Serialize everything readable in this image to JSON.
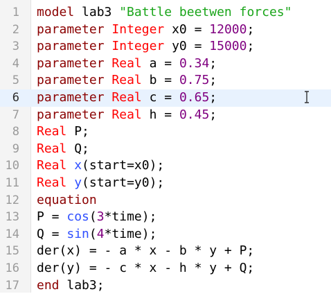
{
  "colors": {
    "keyword": "#8b0000",
    "type": "#ff0000",
    "string": "#1aa51a",
    "number": "#800080",
    "function": "#2f4fff",
    "current_line": "#e8f2fe"
  },
  "cursor": {
    "icon": "text-cursor-icon"
  },
  "editor": {
    "current_line": 6,
    "lines": [
      {
        "n": "1",
        "parts": [
          {
            "t": "kw",
            "v": "model"
          },
          {
            "t": "",
            "v": " lab3 "
          },
          {
            "t": "str",
            "v": "\"Battle beetwen forces\""
          }
        ]
      },
      {
        "n": "2",
        "parts": [
          {
            "t": "kw",
            "v": "parameter"
          },
          {
            "t": "",
            "v": " "
          },
          {
            "t": "typ",
            "v": "Integer"
          },
          {
            "t": "",
            "v": " x0 = "
          },
          {
            "t": "num",
            "v": "12000"
          },
          {
            "t": "",
            "v": ";"
          }
        ]
      },
      {
        "n": "3",
        "parts": [
          {
            "t": "kw",
            "v": "parameter"
          },
          {
            "t": "",
            "v": " "
          },
          {
            "t": "typ",
            "v": "Integer"
          },
          {
            "t": "",
            "v": " y0 = "
          },
          {
            "t": "num",
            "v": "15000"
          },
          {
            "t": "",
            "v": ";"
          }
        ]
      },
      {
        "n": "4",
        "parts": [
          {
            "t": "kw",
            "v": "parameter"
          },
          {
            "t": "",
            "v": " "
          },
          {
            "t": "typ",
            "v": "Real"
          },
          {
            "t": "",
            "v": " a = "
          },
          {
            "t": "num",
            "v": "0.34"
          },
          {
            "t": "",
            "v": ";"
          }
        ]
      },
      {
        "n": "5",
        "parts": [
          {
            "t": "kw",
            "v": "parameter"
          },
          {
            "t": "",
            "v": " "
          },
          {
            "t": "typ",
            "v": "Real"
          },
          {
            "t": "",
            "v": " b = "
          },
          {
            "t": "num",
            "v": "0.75"
          },
          {
            "t": "",
            "v": ";"
          }
        ]
      },
      {
        "n": "6",
        "parts": [
          {
            "t": "kw",
            "v": "parameter"
          },
          {
            "t": "",
            "v": " "
          },
          {
            "t": "typ",
            "v": "Real"
          },
          {
            "t": "",
            "v": " c = "
          },
          {
            "t": "num",
            "v": "0.65"
          },
          {
            "t": "",
            "v": ";"
          }
        ]
      },
      {
        "n": "7",
        "parts": [
          {
            "t": "kw",
            "v": "parameter"
          },
          {
            "t": "",
            "v": " "
          },
          {
            "t": "typ",
            "v": "Real"
          },
          {
            "t": "",
            "v": " h = "
          },
          {
            "t": "num",
            "v": "0.45"
          },
          {
            "t": "",
            "v": ";"
          }
        ]
      },
      {
        "n": "8",
        "parts": [
          {
            "t": "typ",
            "v": "Real"
          },
          {
            "t": "",
            "v": " P;"
          }
        ]
      },
      {
        "n": "9",
        "parts": [
          {
            "t": "typ",
            "v": "Real"
          },
          {
            "t": "",
            "v": " Q;"
          }
        ]
      },
      {
        "n": "10",
        "parts": [
          {
            "t": "typ",
            "v": "Real"
          },
          {
            "t": "",
            "v": " "
          },
          {
            "t": "fn",
            "v": "x"
          },
          {
            "t": "",
            "v": "(start=x0);"
          }
        ]
      },
      {
        "n": "11",
        "parts": [
          {
            "t": "typ",
            "v": "Real"
          },
          {
            "t": "",
            "v": " "
          },
          {
            "t": "fn",
            "v": "y"
          },
          {
            "t": "",
            "v": "(start=y0);"
          }
        ]
      },
      {
        "n": "12",
        "parts": [
          {
            "t": "kw",
            "v": "equation"
          }
        ]
      },
      {
        "n": "13",
        "parts": [
          {
            "t": "",
            "v": "P = "
          },
          {
            "t": "fn",
            "v": "cos"
          },
          {
            "t": "",
            "v": "("
          },
          {
            "t": "num",
            "v": "3"
          },
          {
            "t": "",
            "v": "*time);"
          }
        ]
      },
      {
        "n": "14",
        "parts": [
          {
            "t": "",
            "v": "Q = "
          },
          {
            "t": "fn",
            "v": "sin"
          },
          {
            "t": "",
            "v": "("
          },
          {
            "t": "num",
            "v": "4"
          },
          {
            "t": "",
            "v": "*time);"
          }
        ]
      },
      {
        "n": "15",
        "parts": [
          {
            "t": "",
            "v": "der(x) = - a * x - b * y + P;"
          }
        ]
      },
      {
        "n": "16",
        "parts": [
          {
            "t": "",
            "v": "der(y) = - c * x - h * y + Q;"
          }
        ]
      },
      {
        "n": "17",
        "parts": [
          {
            "t": "kw",
            "v": "end"
          },
          {
            "t": "",
            "v": " lab3;"
          }
        ]
      }
    ]
  }
}
